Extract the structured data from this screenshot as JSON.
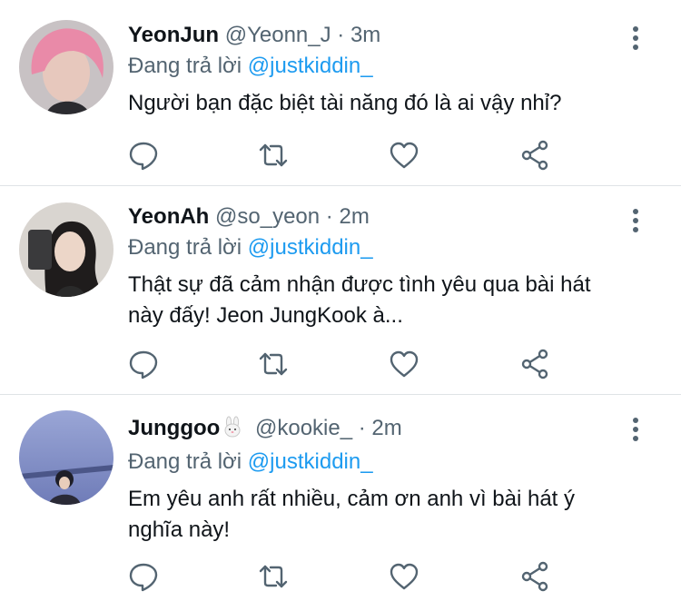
{
  "tweets": [
    {
      "name": "YeonJun",
      "handle": "@Yeonn_J",
      "dot": "·",
      "time": "3m",
      "reply_prefix": "Đang trả lời",
      "reply_to": "@justkiddin_",
      "text": "Người bạn đặc biệt tài năng đó là ai vậy nhỉ?"
    },
    {
      "name": "YeonAh",
      "handle": "@so_yeon",
      "dot": "·",
      "time": "2m",
      "reply_prefix": "Đang trả lời",
      "reply_to": "@justkiddin_",
      "text": "Thật sự đã cảm nhận được tình yêu qua bài hát này đấy! Jeon JungKook à..."
    },
    {
      "name": "Junggoo",
      "name_emoji": "rabbit-face-icon",
      "handle": "@kookie_",
      "dot": "·",
      "time": "2m",
      "reply_prefix": "Đang trả lời",
      "reply_to": "@justkiddin_",
      "text": "Em yêu anh rất nhiều, cảm ơn anh vì bài hát ý nghĩa này!"
    }
  ],
  "action_icons": [
    "reply-icon",
    "retweet-icon",
    "like-icon",
    "share-icon"
  ],
  "colors": {
    "text": "#0f1419",
    "secondary": "#536471",
    "mention": "#1d9bf0",
    "icon": "#536471",
    "divider": "#dfe3e6"
  }
}
